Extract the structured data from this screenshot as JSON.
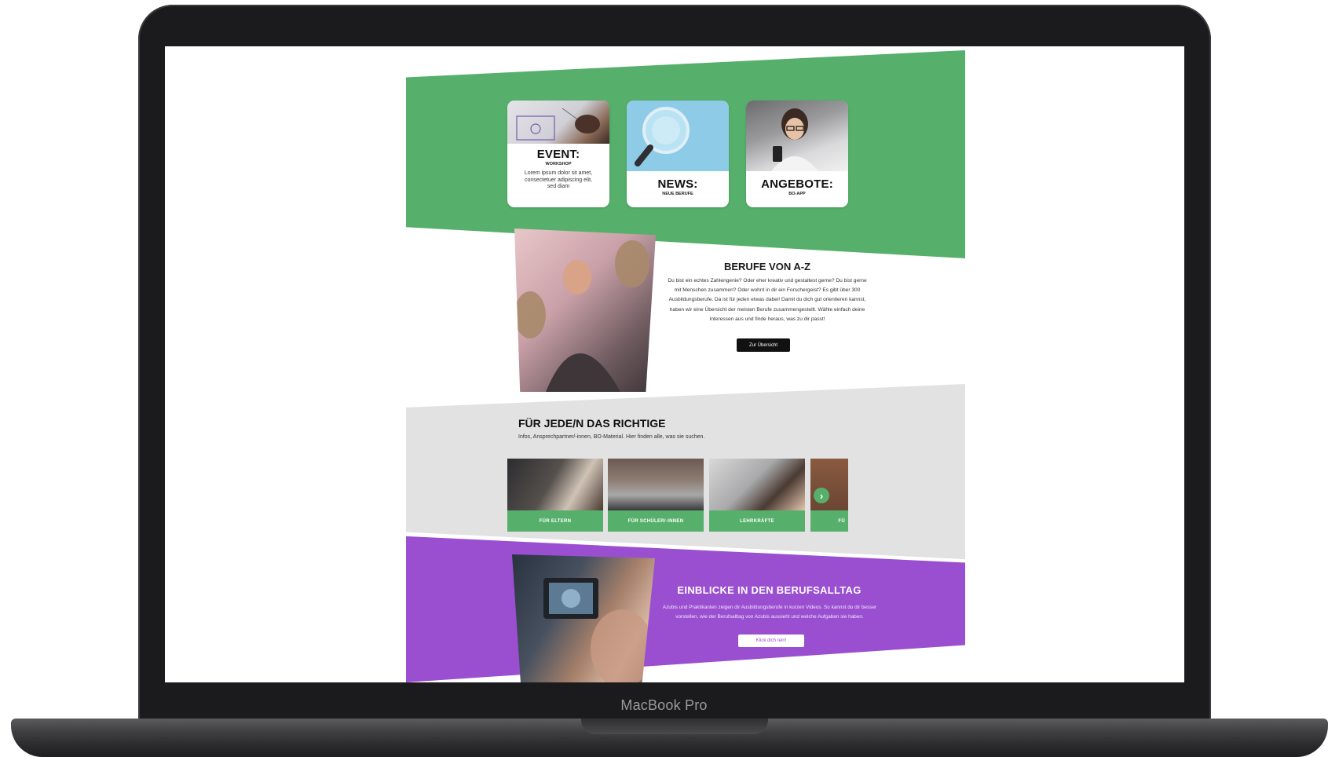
{
  "device": {
    "label": "MacBook Pro"
  },
  "teasers": [
    {
      "title": "EVENT:",
      "subtitle": "WORKSHOP",
      "text": "Lorem ipsum dolor sit amet, consectetuer adipiscing elit, sed diam"
    },
    {
      "title": "NEWS:",
      "subtitle": "NEUE BERUFE"
    },
    {
      "title": "ANGEBOTE:",
      "subtitle": "BO-APP"
    }
  ],
  "berufe": {
    "title": "BERUFE VON A-Z",
    "text": "Du bist ein echtes Zahlengenie? Oder eher kreativ und gestaltest gerne? Du bist gerne mit Menschen zusammen? Oder wohnt in dir ein Forschergeist? Es gibt über 300 Ausbildungsberufe. Da ist für jeden etwas dabei! Damit du dich gut orientieren kannst, haben wir eine Übersicht der meisten Berufe zusammengestellt. Wähle einfach deine Interessen aus und finde heraus, was zu dir passt!",
    "button": "Zur Übersicht"
  },
  "target": {
    "title": "FÜR JEDE/N DAS RICHTIGE",
    "subtitle": "Infos, Ansprechpartner/-innen, BO-Material. Hier finden alle, was sie suchen.",
    "tiles": [
      "FÜR ELTERN",
      "FÜR SCHÜLER/-INNEN",
      "LEHRKRÄFTE",
      "FÜ"
    ],
    "arrow": "›"
  },
  "einblicke": {
    "title": "EINBLICKE IN DEN BERUFSALLTAG",
    "text": "Azubis und Praktikanten zeigen dir Ausbildungsberufe in kurzen Videos. So kannst du dir besser vorstellen, wie der Berufsalltag von Azubis aussieht und welche Aufgaben sie haben.",
    "button": "Klick dich rein!"
  },
  "colors": {
    "green": "#56b06b",
    "purple": "#9a4fd1",
    "gray": "#e2e2e2"
  }
}
